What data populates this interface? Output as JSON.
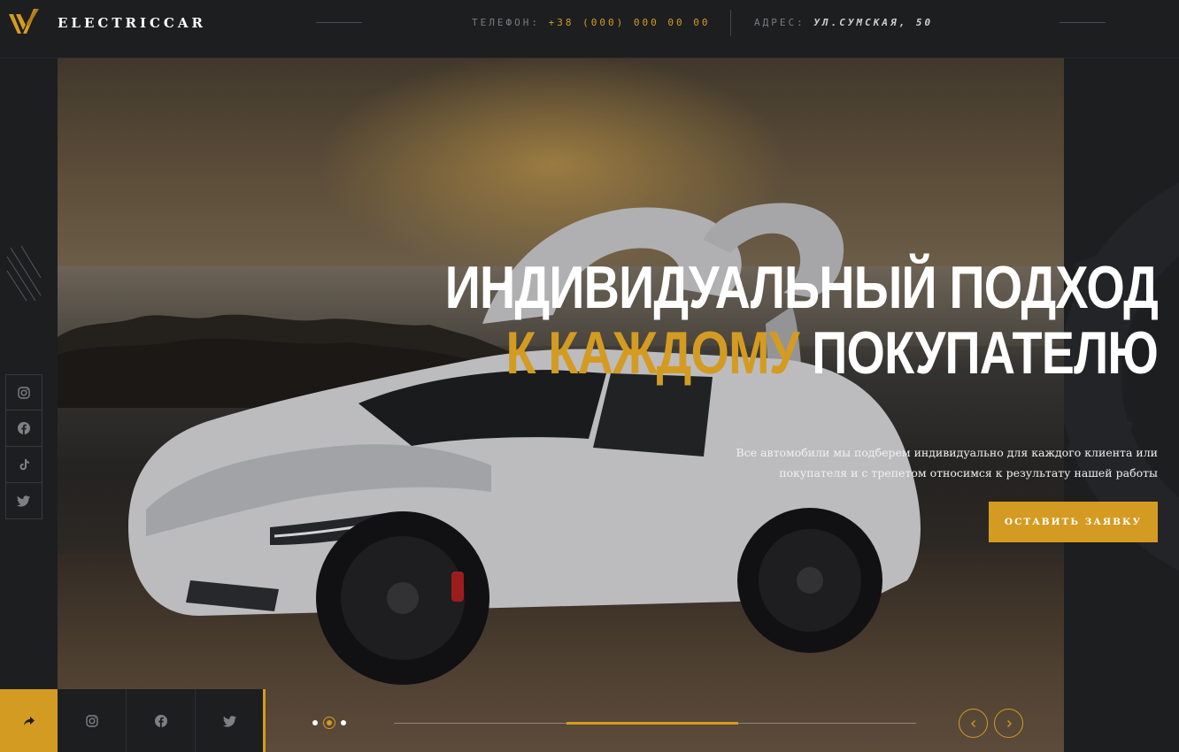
{
  "header": {
    "brand": "ELECTRICCAR",
    "phone_label": "ТЕЛЕФОН:",
    "phone_value": "+38 (000) 000 00 00",
    "address_label": "АДРЕС:",
    "address_value": "УЛ.СУМСКАЯ, 50"
  },
  "social": {
    "vertical": [
      "instagram-icon",
      "facebook-icon",
      "tiktok-icon",
      "twitter-icon"
    ],
    "bottom": [
      "instagram-icon",
      "facebook-icon",
      "twitter-icon"
    ]
  },
  "hero": {
    "headline_line1": "ИНДИВИДУАЛЬНЫЙ ПОДХОД",
    "headline_gold": "К КАЖДОМУ",
    "headline_rest": " ПОКУПАТЕЛЮ",
    "subtext": "Все автомобили мы подберем индивидуально для каждого клиента или покупателя и с трепетом относимся к результату нашей работы",
    "cta_label": "ОСТАВИТЬ ЗАЯВКУ"
  },
  "slider": {
    "slide_count": 3,
    "active_slide": 2,
    "progress_start": 0.33,
    "progress_end": 0.66
  },
  "colors": {
    "accent": "#d49b22",
    "background": "#1d1e20"
  }
}
